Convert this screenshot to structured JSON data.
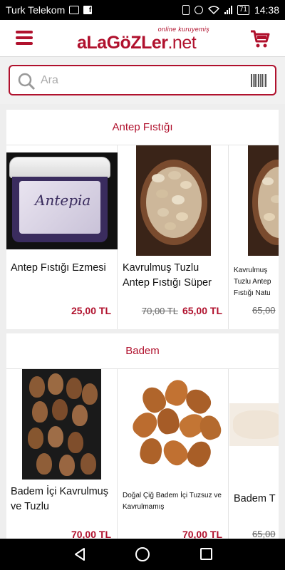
{
  "status_bar": {
    "carrier": "Turk Telekom",
    "battery": "71",
    "time": "14:38"
  },
  "header": {
    "logo_text": "aLaGöZLer",
    "logo_suffix": ".net",
    "logo_tagline": "online kuruyemiş",
    "brand_color": "#b0112d"
  },
  "search": {
    "placeholder": "Ara"
  },
  "sections": [
    {
      "title": "Antep Fıstığı",
      "products": [
        {
          "name": "Antep Fıstığı Ezmesi",
          "old_price": "",
          "price": "25,00 TL"
        },
        {
          "name": "Kavrulmuş Tuzlu Antep Fıstığı Süper",
          "old_price": "70,00 TL",
          "price": "65,00 TL"
        },
        {
          "name": "Kavrulmuş Tuzlu Antep Fıstığı Natu",
          "old_price": "65,00",
          "price": ""
        }
      ]
    },
    {
      "title": "Badem",
      "products": [
        {
          "name": "Badem İçi Kavrulmuş ve Tuzlu",
          "old_price": "",
          "price": "70,00 TL"
        },
        {
          "name": "Doğal Çiğ Badem İçi Tuzsuz ve Kavrulmamış",
          "old_price": "",
          "price": "70,00 TL"
        },
        {
          "name": "Badem T",
          "old_price": "65,00",
          "price": ""
        }
      ]
    }
  ]
}
